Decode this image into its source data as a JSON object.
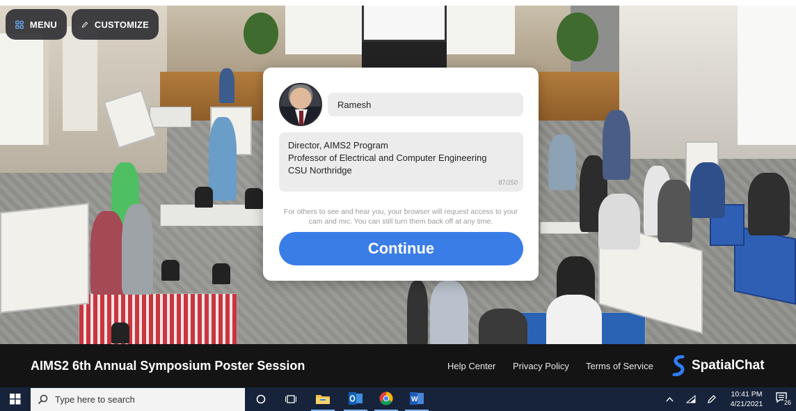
{
  "toolbar": {
    "menu_label": "MENU",
    "customize_label": "CUSTOMIZE"
  },
  "profile": {
    "name_value": "Ramesh",
    "bio_lines": [
      "Director, AIMS2 Program",
      "Professor of Electrical and Computer Engineering",
      "CSU Northridge"
    ],
    "char_counter": "87/250",
    "notice": "For others to see and hear you, your browser will request access to your cam and mic. You can still turn them back off at any time.",
    "continue_label": "Continue"
  },
  "footer": {
    "event_title": "AIMS2 6th Annual Symposium Poster Session",
    "links": [
      "Help Center",
      "Privacy Policy",
      "Terms of Service"
    ],
    "brand_name": "SpatialChat",
    "brand_color": "#2f7cf6"
  },
  "taskbar": {
    "search_placeholder": "Type here to search",
    "time": "10:41 PM",
    "date": "4/21/2021",
    "notification_count": "26",
    "pinned_apps": [
      "task-view-icon",
      "file-explorer-icon",
      "outlook-icon",
      "chrome-icon",
      "word-icon"
    ]
  },
  "colors": {
    "accent": "#3b7de6",
    "footer_bg": "#141414",
    "taskbar_bg": "#17233a"
  }
}
